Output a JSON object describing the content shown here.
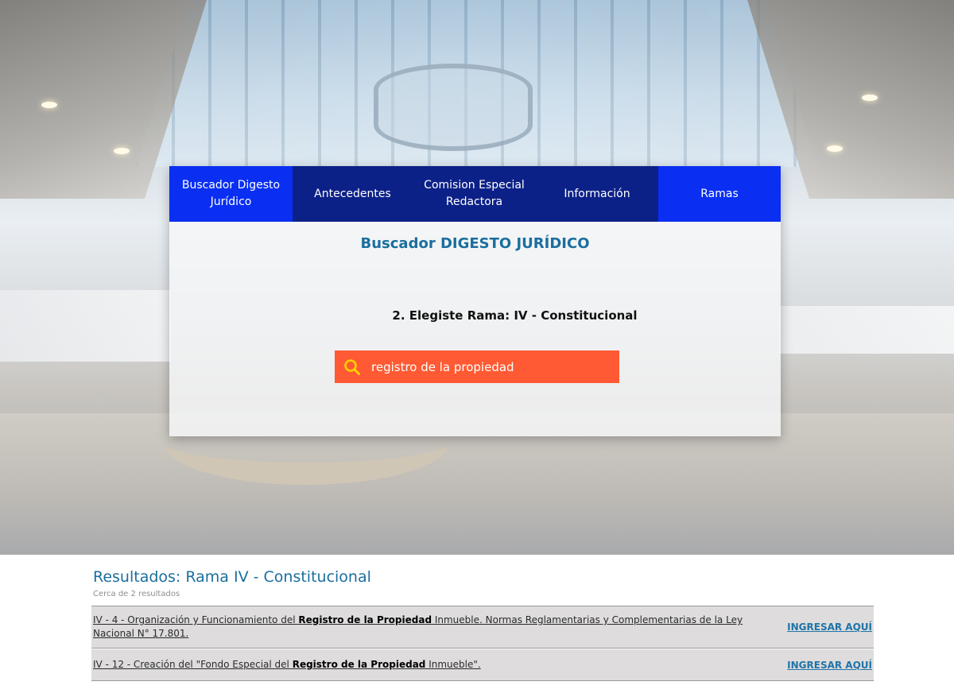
{
  "nav": {
    "items": [
      {
        "label": "Buscador Digesto Jurídico",
        "line1": "Buscador Digesto",
        "line2": "Jurídico"
      },
      {
        "label": "Antecedentes",
        "line1": "Antecedentes",
        "line2": ""
      },
      {
        "label": "Comision Especial Redactora",
        "line1": "Comision Especial",
        "line2": "Redactora"
      },
      {
        "label": "Información",
        "line1": "Información",
        "line2": ""
      },
      {
        "label": "Ramas",
        "line1": "Ramas",
        "line2": ""
      }
    ]
  },
  "panel": {
    "title": "Buscador DIGESTO JURÍDICO",
    "rama_label": "2. Elegiste Rama: IV - Constitucional"
  },
  "search": {
    "value": "registro de la propiedad",
    "icon": "search-icon"
  },
  "results": {
    "heading": "Resultados: Rama IV - Constitucional",
    "count": "Cerca de 2 resultados",
    "rows": [
      {
        "text_before": "IV - 4 - Organización y Funcionamiento del ",
        "text_bold": "Registro de la Propiedad",
        "text_after": " Inmueble. Normas Reglamentarias y Complementarias de la Ley Nacional N° 17.801.",
        "link": "INGRESAR AQUÍ"
      },
      {
        "text_before": "IV - 12 - Creación del \"Fondo Especial del ",
        "text_bold": "Registro de la Propiedad",
        "text_after": " Inmueble\".",
        "link": "INGRESAR AQUÍ"
      }
    ]
  },
  "colors": {
    "nav_bright": "#0a2ff2",
    "nav_dark": "#0c2188",
    "search_bg": "#ff5a33",
    "heading": "#1a6e9e",
    "search_icon": "#ffd000"
  }
}
